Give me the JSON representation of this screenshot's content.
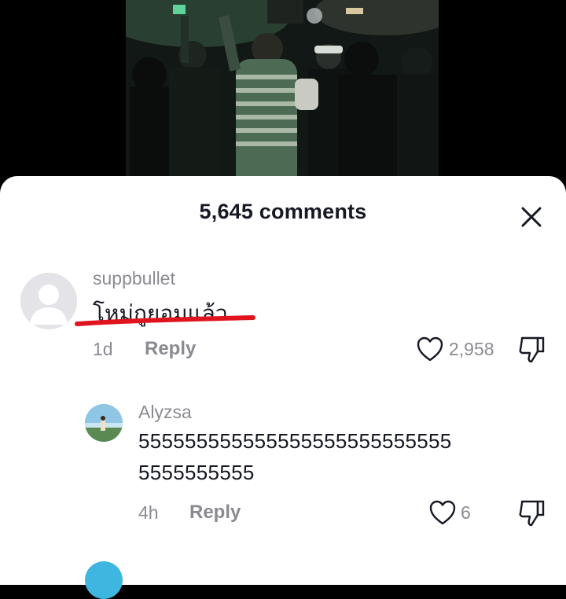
{
  "sheet": {
    "title": "5,645 comments"
  },
  "icons": {
    "close": "close-icon",
    "like": "heart-icon",
    "dislike": "thumbs-down-icon"
  },
  "colors": {
    "annotation": "#e0141e",
    "text": "#161823",
    "muted": "#8a8b91"
  },
  "comments": [
    {
      "username": "suppbullet",
      "text": "โหม่กูยอมแล้ว",
      "time": "1d",
      "reply_label": "Reply",
      "likes": "2,958"
    },
    {
      "username": "Alyzsa",
      "text_line1": "555555555555555555555555555",
      "text_line2": "5555555555",
      "time": "4h",
      "reply_label": "Reply",
      "likes": "6"
    }
  ]
}
